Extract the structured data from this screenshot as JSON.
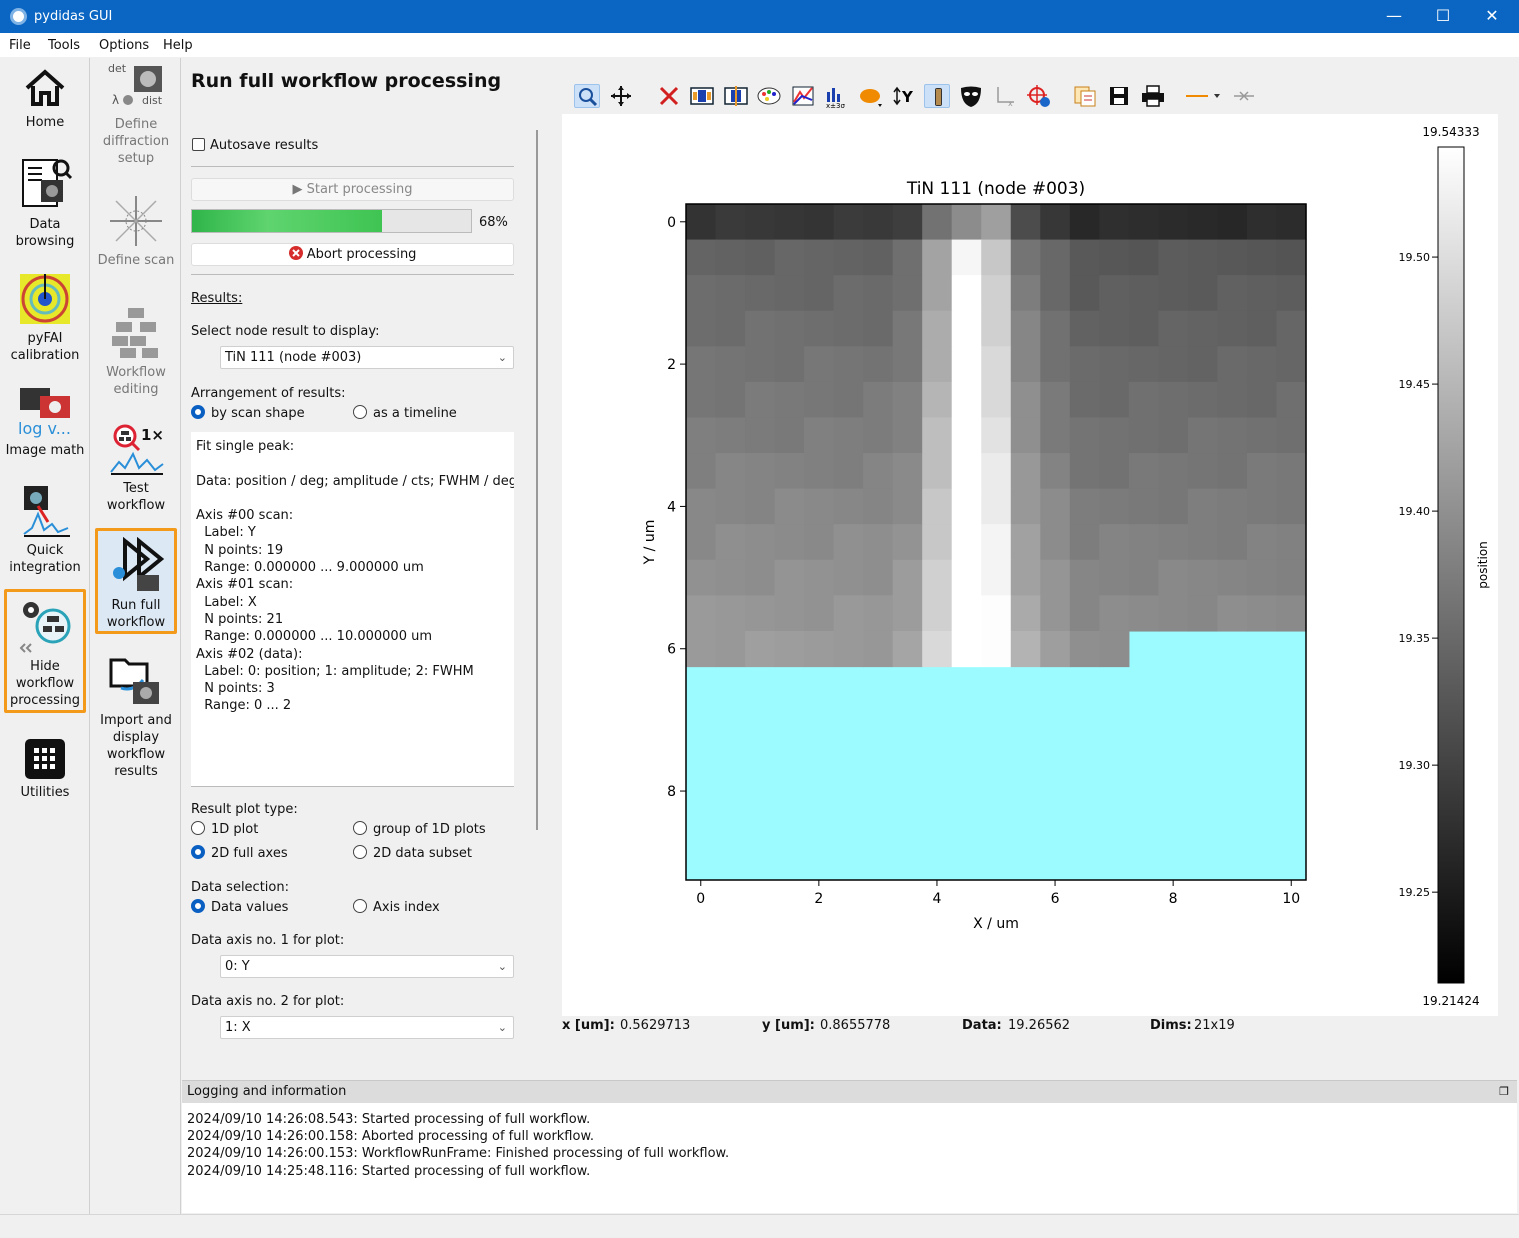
{
  "window": {
    "title": "pydidas GUI",
    "minimize": "—",
    "maximize": "☐",
    "close": "✕"
  },
  "menu": [
    "File",
    "Tools",
    "Options",
    "Help"
  ],
  "sidebar": {
    "items": [
      {
        "label": "Home",
        "icon": "home-icon"
      },
      {
        "label": "Data browsing",
        "icon": "data-browsing-icon"
      },
      {
        "label": "pyFAI calibration",
        "icon": "pyfai-calibration-icon"
      },
      {
        "label": "Image math",
        "icon": "image-math-icon",
        "overlay": "log v..."
      },
      {
        "label": "Quick integration",
        "icon": "quick-integration-icon"
      },
      {
        "label": "Hide workflow processing",
        "icon": "workflow-processing-icon",
        "highlighted": true
      },
      {
        "label": "Utilities",
        "icon": "utilities-icon"
      }
    ]
  },
  "subbar": {
    "items": [
      {
        "label": "Define diffraction setup",
        "icon": "diffraction-setup-icon",
        "mini": [
          "det",
          "λ",
          "dist"
        ]
      },
      {
        "label": "Define scan",
        "icon": "define-scan-icon"
      },
      {
        "label": "Workflow editing",
        "icon": "workflow-editing-icon"
      },
      {
        "label": "Test workflow",
        "icon": "test-workflow-icon",
        "badge": "1×"
      },
      {
        "label": "Run full workflow",
        "icon": "run-full-workflow-icon",
        "highlighted": true
      },
      {
        "label": "Import and display workflow results",
        "icon": "import-results-icon"
      }
    ]
  },
  "panel": {
    "title": "Run full workflow processing",
    "autosave_label": "Autosave results",
    "start_label": "Start processing",
    "progress": 0.68,
    "progress_text": "68%",
    "abort_label": "Abort processing",
    "results_heading": "Results:",
    "select_node_label": "Select node result to display:",
    "node_value": "TiN 111 (node #003)",
    "arrangement_label": "Arrangement of results:",
    "arr_scan": "by scan shape",
    "arr_timeline": "as a timeline",
    "info_text": "Fit single peak:\n\nData: position / deg; amplitude / cts; FWHM / deg\n\nAxis #00 scan:\n  Label: Y\n  N points: 19\n  Range: 0.000000 ... 9.000000 um\nAxis #01 scan:\n  Label: X\n  N points: 21\n  Range: 0.000000 ... 10.000000 um\nAxis #02 (data):\n  Label: 0: position; 1: amplitude; 2: FWHM\n  N points: 3\n  Range: 0 ... 2",
    "plot_type_label": "Result plot type:",
    "pt_1d": "1D plot",
    "pt_group": "group of 1D plots",
    "pt_2d": "2D full axes",
    "pt_subset": "2D data subset",
    "data_sel_label": "Data selection:",
    "ds_values": "Data values",
    "ds_index": "Axis index",
    "axis1_label": "Data axis no. 1 for plot:",
    "axis1_value": "0: Y",
    "axis2_label": "Data axis no. 2 for plot:",
    "axis2_value": "1: X"
  },
  "toolbar_icons": [
    "zoom-icon",
    "pan-icon",
    "reset-zoom-icon",
    "colormap-icon",
    "colorbar-range-icon",
    "colormap-dialog-icon",
    "histogram-icon",
    "stats-icon",
    "roi-icon",
    "y-axis-invert-icon",
    "aspect-ratio-icon",
    "mask-icon",
    "axes-origin-icon",
    "crosshair-icon",
    "copy-icon",
    "save-icon",
    "print-icon",
    "line-style-icon",
    "curve-symbol-icon"
  ],
  "plot": {
    "title": "TiN 111 (node #003)",
    "xlabel": "X / um",
    "ylabel": "Y / um",
    "xticks": [
      "0",
      "2",
      "4",
      "6",
      "8",
      "10"
    ],
    "yticks": [
      "0",
      "2",
      "4",
      "6",
      "8"
    ],
    "colorbar_label": "position",
    "colorbar_max": "19.54333",
    "colorbar_min": "19.21424",
    "colorbar_ticks": [
      "19.50",
      "19.45",
      "19.40",
      "19.35",
      "19.30",
      "19.25"
    ],
    "nan_color": "#9cfbff"
  },
  "coords": {
    "x_label": "x [um]:",
    "x_value": "0.5629713",
    "y_label": "y [um]:",
    "y_value": "0.8655778",
    "data_label": "Data:",
    "data_value": "19.26562",
    "dims_label": "Dims:",
    "dims_value": "21x19"
  },
  "log": {
    "title": "Logging and information",
    "undock": "❐",
    "lines": [
      "2024/09/10 14:26:08.543: Started processing of full workflow.",
      "2024/09/10 14:26:00.158: Aborted processing of full workflow.",
      "2024/09/10 14:26:00.153: WorkflowRunFrame: Finished processing of full workflow.",
      "2024/09/10 14:25:48.116: Started processing of full workflow."
    ]
  }
}
